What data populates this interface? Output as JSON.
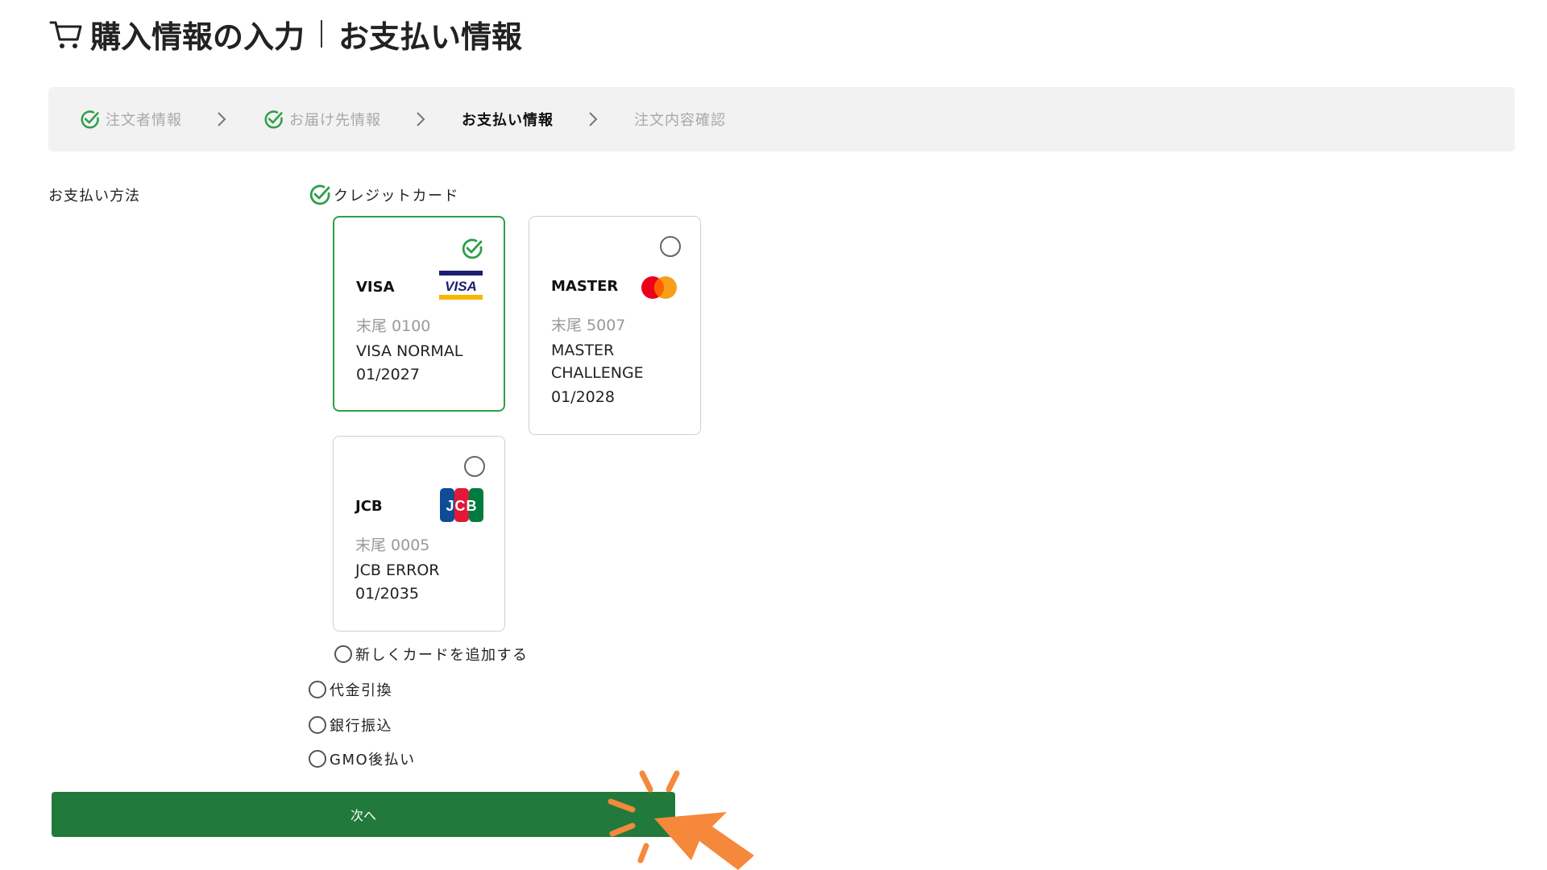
{
  "header": {
    "title": "購入情報の入力",
    "subtitle": "お支払い情報"
  },
  "stepper": {
    "steps": [
      {
        "label": "注文者情報",
        "state": "done"
      },
      {
        "label": "お届け先情報",
        "state": "done"
      },
      {
        "label": "お支払い情報",
        "state": "current"
      },
      {
        "label": "注文内容確認",
        "state": "todo"
      }
    ]
  },
  "payment": {
    "label": "お支払い方法",
    "credit_card_label": "クレジットカード",
    "cards": [
      {
        "brand": "VISA",
        "digits": "末尾 0100",
        "name": "VISA NORMAL",
        "exp": "01/2027",
        "selected": true,
        "logo_text": "VISA"
      },
      {
        "brand": "MASTER",
        "digits": "末尾 5007",
        "name": "MASTER CHALLENGE",
        "exp": "01/2028",
        "selected": false
      },
      {
        "brand": "JCB",
        "digits": "末尾 0005",
        "name": "JCB ERROR",
        "exp": "01/2035",
        "selected": false,
        "logo_text": "JCB"
      }
    ],
    "add_card_label": "新しくカードを追加する",
    "other_methods": [
      "代金引換",
      "銀行振込",
      "GMO後払い"
    ]
  },
  "next_button_label": "次へ",
  "colors": {
    "accent_green": "#2e9f4a",
    "button_green": "#217a3c",
    "cursor_orange": "#f5883a"
  }
}
